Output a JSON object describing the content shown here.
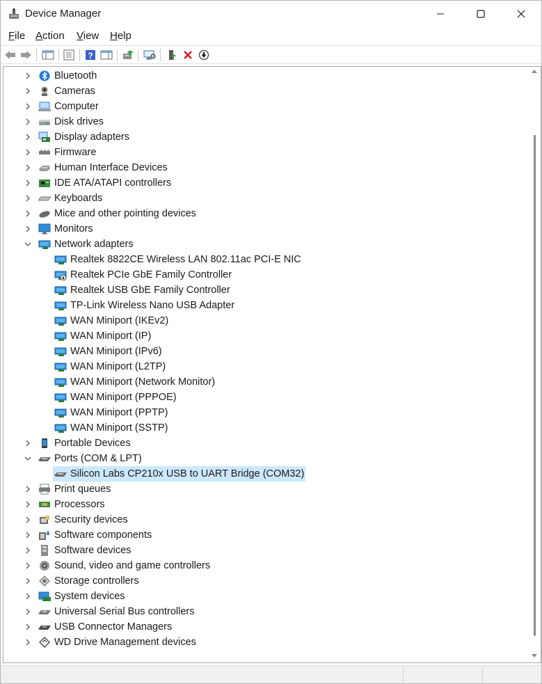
{
  "window": {
    "title": "Device Manager",
    "app_icon": "device-manager-icon",
    "controls": [
      "minimize-icon",
      "maximize-icon",
      "close-icon"
    ]
  },
  "menu": [
    {
      "label": "File",
      "mnemonic": "F",
      "rest": "ile"
    },
    {
      "label": "Action",
      "mnemonic": "A",
      "rest": "ction"
    },
    {
      "label": "View",
      "mnemonic": "V",
      "rest": "iew"
    },
    {
      "label": "Help",
      "mnemonic": "H",
      "rest": "elp"
    }
  ],
  "toolbar": [
    "back-arrow-icon",
    "forward-arrow-icon",
    "show-hide-console-tree-icon",
    "properties-icon",
    "help-icon",
    "action-pane-icon",
    "update-driver-icon",
    "scan-hardware-changes-icon",
    "enable-device-icon",
    "uninstall-device-icon",
    "disable-device-icon"
  ],
  "tree": [
    {
      "label": "Bluetooth",
      "icon": "bluetooth-icon",
      "level": 0,
      "state": "collapsed"
    },
    {
      "label": "Cameras",
      "icon": "camera-icon",
      "level": 0,
      "state": "collapsed"
    },
    {
      "label": "Computer",
      "icon": "computer-icon",
      "level": 0,
      "state": "collapsed"
    },
    {
      "label": "Disk drives",
      "icon": "disk-drive-icon",
      "level": 0,
      "state": "collapsed"
    },
    {
      "label": "Display adapters",
      "icon": "display-adapter-icon",
      "level": 0,
      "state": "collapsed"
    },
    {
      "label": "Firmware",
      "icon": "firmware-icon",
      "level": 0,
      "state": "collapsed"
    },
    {
      "label": "Human Interface Devices",
      "icon": "hid-icon",
      "level": 0,
      "state": "collapsed"
    },
    {
      "label": "IDE ATA/ATAPI controllers",
      "icon": "ide-controller-icon",
      "level": 0,
      "state": "collapsed"
    },
    {
      "label": "Keyboards",
      "icon": "keyboard-icon",
      "level": 0,
      "state": "collapsed"
    },
    {
      "label": "Mice and other pointing devices",
      "icon": "mouse-icon",
      "level": 0,
      "state": "collapsed"
    },
    {
      "label": "Monitors",
      "icon": "monitor-icon",
      "level": 0,
      "state": "collapsed"
    },
    {
      "label": "Network adapters",
      "icon": "network-adapter-icon",
      "level": 0,
      "state": "expanded"
    },
    {
      "label": "Realtek 8822CE Wireless LAN 802.11ac PCI-E NIC",
      "icon": "network-adapter-icon",
      "level": 1
    },
    {
      "label": "Realtek PCIe GbE Family Controller",
      "icon": "network-adapter-disabled-icon",
      "level": 1
    },
    {
      "label": "Realtek USB GbE Family Controller",
      "icon": "network-adapter-icon",
      "level": 1
    },
    {
      "label": "TP-Link Wireless Nano USB Adapter",
      "icon": "network-adapter-icon",
      "level": 1
    },
    {
      "label": "WAN Miniport (IKEv2)",
      "icon": "network-adapter-icon",
      "level": 1
    },
    {
      "label": "WAN Miniport (IP)",
      "icon": "network-adapter-icon",
      "level": 1
    },
    {
      "label": "WAN Miniport (IPv6)",
      "icon": "network-adapter-icon",
      "level": 1
    },
    {
      "label": "WAN Miniport (L2TP)",
      "icon": "network-adapter-icon",
      "level": 1
    },
    {
      "label": "WAN Miniport (Network Monitor)",
      "icon": "network-adapter-icon",
      "level": 1
    },
    {
      "label": "WAN Miniport (PPPOE)",
      "icon": "network-adapter-icon",
      "level": 1
    },
    {
      "label": "WAN Miniport (PPTP)",
      "icon": "network-adapter-icon",
      "level": 1
    },
    {
      "label": "WAN Miniport (SSTP)",
      "icon": "network-adapter-icon",
      "level": 1
    },
    {
      "label": "Portable Devices",
      "icon": "portable-device-icon",
      "level": 0,
      "state": "collapsed"
    },
    {
      "label": "Ports (COM & LPT)",
      "icon": "port-icon",
      "level": 0,
      "state": "expanded"
    },
    {
      "label": "Silicon Labs CP210x USB to UART Bridge (COM32)",
      "icon": "port-icon",
      "level": 1,
      "selected": true
    },
    {
      "label": "Print queues",
      "icon": "printer-icon",
      "level": 0,
      "state": "collapsed"
    },
    {
      "label": "Processors",
      "icon": "processor-icon",
      "level": 0,
      "state": "collapsed"
    },
    {
      "label": "Security devices",
      "icon": "security-device-icon",
      "level": 0,
      "state": "collapsed"
    },
    {
      "label": "Software components",
      "icon": "software-component-icon",
      "level": 0,
      "state": "collapsed"
    },
    {
      "label": "Software devices",
      "icon": "software-device-icon",
      "level": 0,
      "state": "collapsed"
    },
    {
      "label": "Sound, video and game controllers",
      "icon": "speaker-icon",
      "level": 0,
      "state": "collapsed"
    },
    {
      "label": "Storage controllers",
      "icon": "storage-controller-icon",
      "level": 0,
      "state": "collapsed"
    },
    {
      "label": "System devices",
      "icon": "system-device-icon",
      "level": 0,
      "state": "collapsed"
    },
    {
      "label": "Universal Serial Bus controllers",
      "icon": "usb-controller-icon",
      "level": 0,
      "state": "collapsed"
    },
    {
      "label": "USB Connector Managers",
      "icon": "usb-connector-icon",
      "level": 0,
      "state": "collapsed"
    },
    {
      "label": "WD Drive Management devices",
      "icon": "wd-drive-icon",
      "level": 0,
      "state": "collapsed"
    }
  ],
  "colors": {
    "selection": "#cce8ff",
    "chevron": "#5a5a5a",
    "network_blue": "#2f8fd6",
    "bluetooth_blue": "#1f7ad8",
    "delete_red": "#d61f1f"
  }
}
